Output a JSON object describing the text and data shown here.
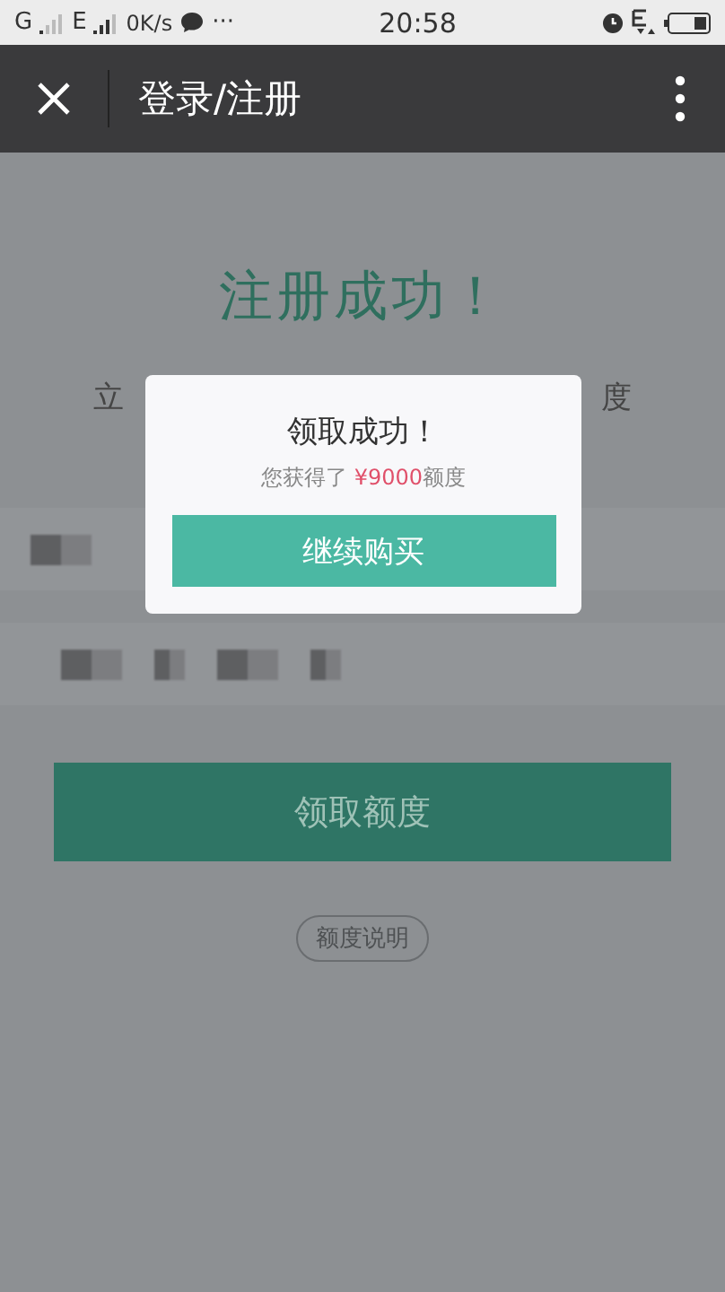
{
  "status_bar": {
    "carrier_1": "G",
    "carrier_2": "E",
    "speed": "0K/s",
    "more": "···",
    "time": "20:58"
  },
  "header": {
    "title": "登录/注册"
  },
  "page": {
    "heading": "注册成功！",
    "subtitle_left": "立",
    "subtitle_right": "度",
    "primary_button": "领取额度",
    "info_link": "额度说明"
  },
  "dialog": {
    "title": "领取成功！",
    "message_prefix": "您获得了",
    "amount": "¥9000",
    "message_suffix": "额度",
    "button": "继续购买"
  }
}
